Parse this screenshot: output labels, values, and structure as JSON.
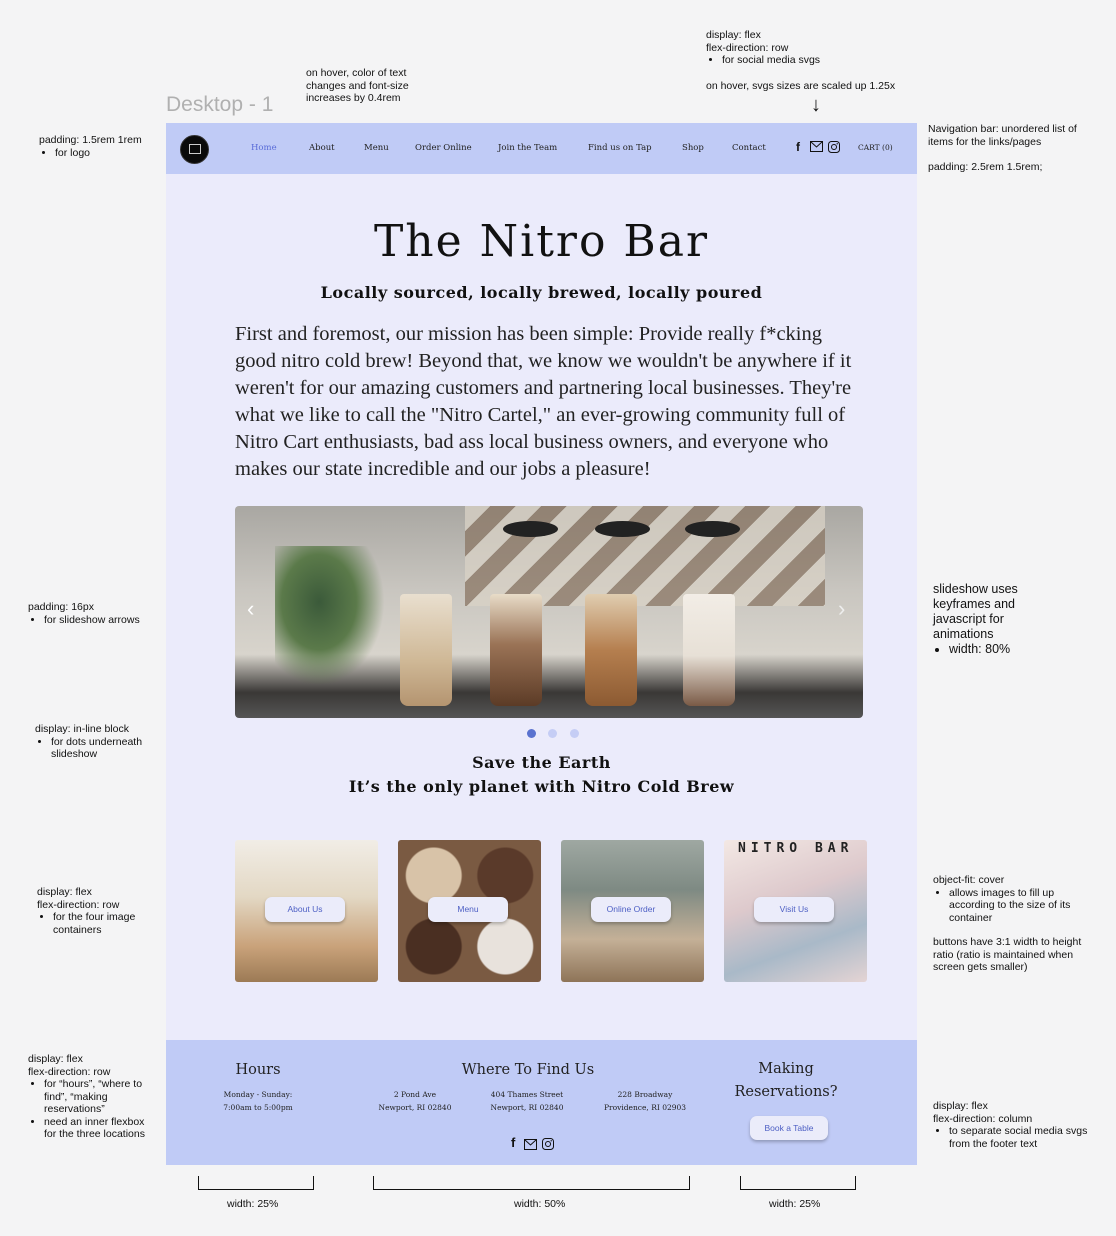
{
  "frame_label": "Desktop - 1",
  "annotations": {
    "hover_text": "on hover, color of text changes and font-size increases by 0.4rem",
    "social_flex_1": "display: flex",
    "social_flex_2": "flex-direction: row",
    "social_flex_3": "for social media svgs",
    "social_hover": "on hover, svgs sizes are scaled up 1.25x",
    "logo_padding": "padding: 1.5rem 1rem",
    "logo_padding_for": "for logo",
    "nav_desc": "Navigation bar: unordered list of items for the links/pages",
    "nav_padding": "padding: 2.5rem 1.5rem;",
    "arrows_padding": "padding: 16px",
    "arrows_for": "for slideshow arrows",
    "slideshow_1": "slideshow uses keyframes and javascript for animations",
    "slideshow_width": "width: 80%",
    "dots_1": "display: in-line block",
    "dots_for": "for dots underneath slideshow",
    "cards_1": "display: flex",
    "cards_2": "flex-direction: row",
    "cards_for": "for the four image containers",
    "object_fit": "object-fit: cover",
    "object_fit_desc": "allows images to fill up according to the size of its container",
    "buttons_ratio": "buttons have 3:1 width to height ratio (ratio is maintained when screen gets smaller)",
    "footer_left_1": "display: flex",
    "footer_left_2": "flex-direction: row",
    "footer_left_b1": "for “hours”, “where to find”, “making reservations”",
    "footer_left_b2": "need an inner flexbox for the three locations",
    "footer_right_1": "display: flex",
    "footer_right_2": "flex-direction: column",
    "footer_right_b1": "to separate social media svgs from the footer text",
    "width_left": "width: 25%",
    "width_middle": "width: 50%",
    "width_right": "width: 25%"
  },
  "nav": {
    "items": [
      "Home",
      "About",
      "Menu",
      "Order Online",
      "Join the Team",
      "Find us on Tap",
      "Shop",
      "Contact"
    ],
    "active": "Home",
    "cart": "CART (0)"
  },
  "hero": {
    "title": "The Nitro Bar",
    "tagline": "Locally sourced, locally brewed, locally poured",
    "mission": "First and foremost, our mission has been simple: Provide really f*cking good nitro cold brew! Beyond that, we know we wouldn't be anywhere if it weren't for our amazing customers and partnering local businesses. They're what we like to call the \"Nitro Cartel,\" an ever-growing community full of Nitro Cart enthusiasts, bad ass local business owners, and everyone who makes our state incredible and our jobs a pleasure!"
  },
  "slideshow": {
    "prev_arrow": "‹",
    "next_arrow": "›",
    "dot_count": 3,
    "active_dot": 0
  },
  "promo": {
    "line1": "Save the Earth",
    "line2": "It’s the only planet with Nitro Cold Brew"
  },
  "cards": [
    {
      "button": "About Us"
    },
    {
      "button": "Menu"
    },
    {
      "button": "Online Order"
    },
    {
      "button": "Visit Us",
      "sign_text": "NITRO BAR"
    }
  ],
  "footer": {
    "hours_title": "Hours",
    "hours_days": "Monday - Sunday:",
    "hours_time": "7:00am to 5:00pm",
    "find_title": "Where To Find Us",
    "locations": [
      {
        "street": "2 Pond Ave",
        "city": "Newport, RI 02840"
      },
      {
        "street": "404 Thames Street",
        "city": "Newport, RI 02840"
      },
      {
        "street": "228 Broadway",
        "city": "Providence, RI 02903"
      }
    ],
    "res_title_1": "Making",
    "res_title_2": "Reservations?",
    "book_button": "Book a Table"
  },
  "colors": {
    "nav_bg": "#c0cbf6",
    "page_bg": "#ebebfb",
    "accent": "#4d5fc4"
  }
}
